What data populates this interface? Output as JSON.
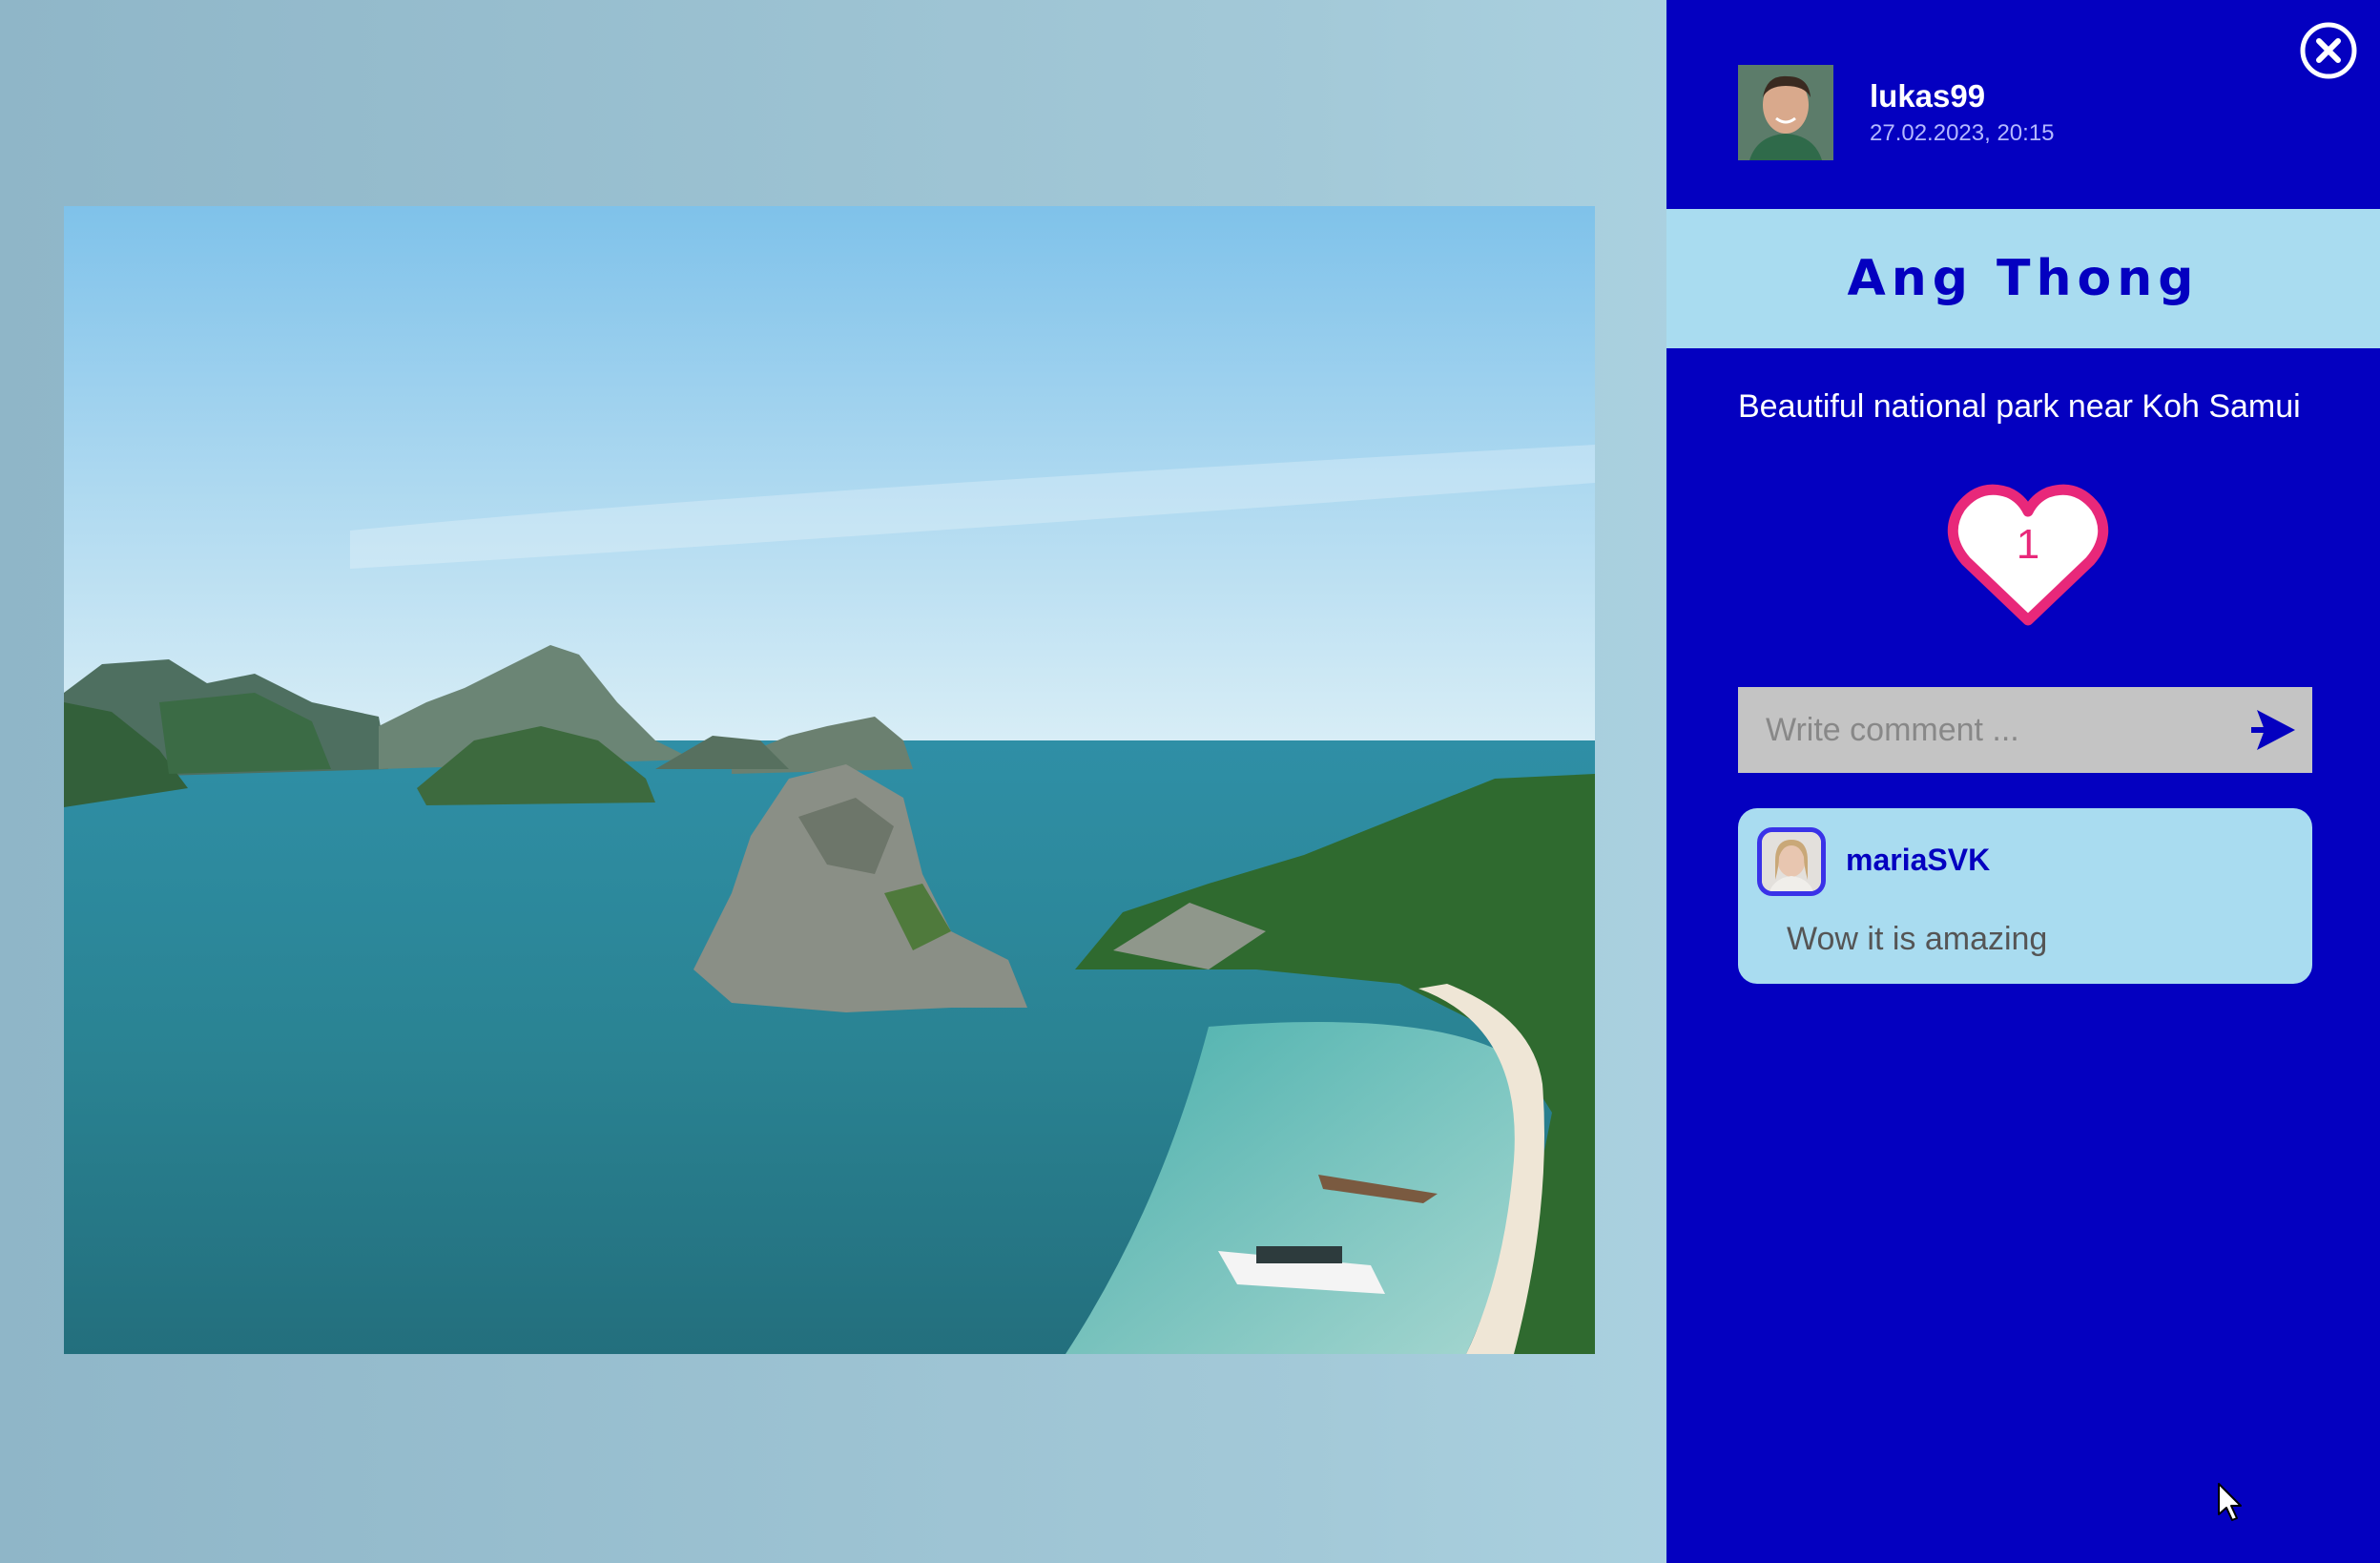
{
  "post": {
    "author": {
      "name": "lukas99",
      "date": "27.02.2023, 20:15"
    },
    "title": "Ang Thong",
    "description": "Beautiful national park near Koh Samui",
    "likes": "1",
    "photo_icon": "landscape-photo"
  },
  "comment_form": {
    "placeholder": "Write comment ...",
    "send_icon": "send-arrow-icon"
  },
  "comments": [
    {
      "user": "mariaSVK",
      "text": "Wow it is amazing"
    }
  ],
  "icons": {
    "close": "close-circle-icon",
    "like": "heart-icon"
  },
  "colors": {
    "panel": "#0400c0",
    "title_band": "#a9dcf0",
    "heart": "#e8287a",
    "comment_card": "#a9dcf0",
    "input": "#c4c4c4"
  }
}
